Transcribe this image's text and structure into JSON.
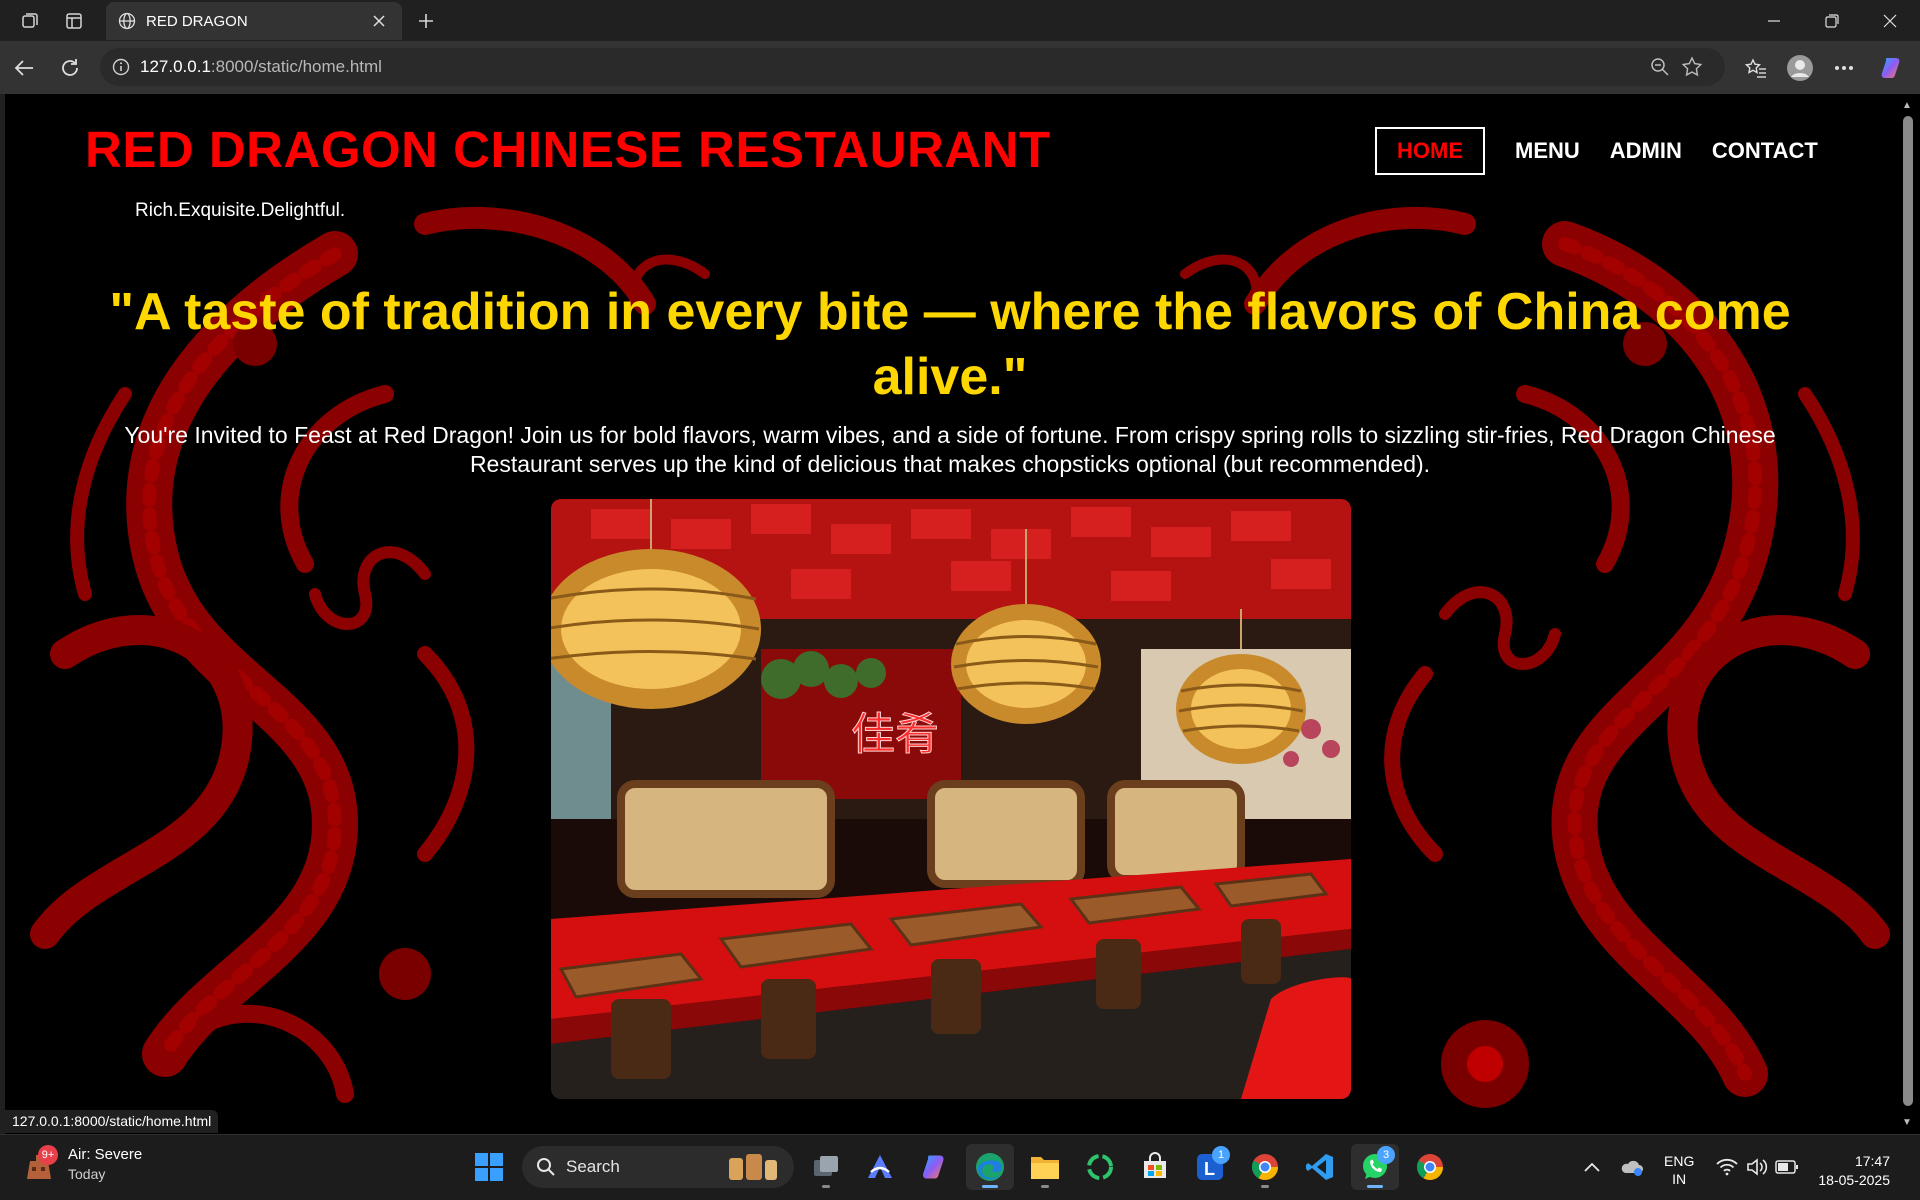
{
  "browser": {
    "tab_title": "RED DRAGON",
    "url_host": "127.0.0.1",
    "url_path": ":8000/static/home.html",
    "status_url": "127.0.0.1:8000/static/home.html"
  },
  "site": {
    "title": "RED DRAGON CHINESE RESTAURANT",
    "tagline": "Rich.Exquisite.Delightful.",
    "nav": [
      {
        "label": "HOME",
        "active": true
      },
      {
        "label": "MENU",
        "active": false
      },
      {
        "label": "ADMIN",
        "active": false
      },
      {
        "label": "CONTACT",
        "active": false
      }
    ],
    "hero_quote": "\"A taste of tradition in every bite — where the flavors of China come alive.\"",
    "hero_text": "You're Invited to Feast at Red Dragon! Join us for bold flavors, warm vibes, and a side of fortune. From crispy spring rolls to sizzling stir-fries, Red Dragon Chinese Restaurant serves up the kind of delicious that makes chopsticks optional (but recommended).",
    "neon_sign": "佳肴",
    "colors": {
      "title_red": "#ff0000",
      "quote_gold": "#ffd700",
      "background": "#000000",
      "dragon_red": "#8b0000"
    }
  },
  "taskbar": {
    "weather_badge": "9+",
    "weather_title": "Air: Severe",
    "weather_sub": "Today",
    "search_label": "Search",
    "apps": [
      {
        "name": "start-icon"
      },
      {
        "name": "task-view-icon"
      },
      {
        "name": "arc-icon"
      },
      {
        "name": "copilot-icon"
      },
      {
        "name": "edge-icon",
        "active": true
      },
      {
        "name": "file-explorer-icon"
      },
      {
        "name": "refresh-app-icon"
      },
      {
        "name": "store-icon"
      },
      {
        "name": "lens-app-icon",
        "badge": "1"
      },
      {
        "name": "chrome-icon"
      },
      {
        "name": "vscode-icon"
      },
      {
        "name": "whatsapp-icon",
        "badge": "3"
      },
      {
        "name": "chrome-icon-2"
      }
    ],
    "lang_line1": "ENG",
    "lang_line2": "IN",
    "time": "17:47",
    "date": "18-05-2025"
  }
}
